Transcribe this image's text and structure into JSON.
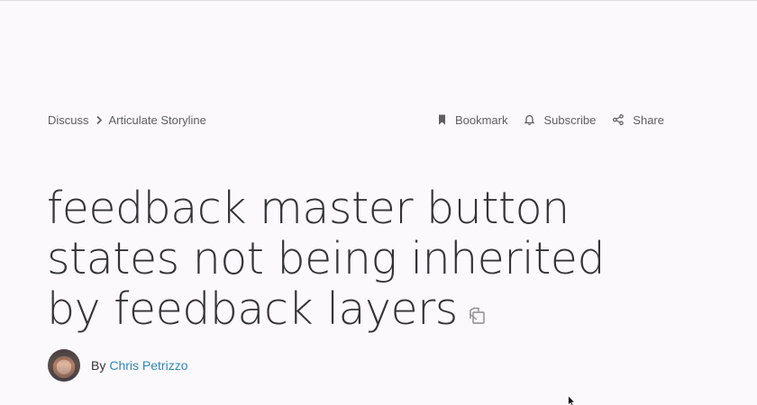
{
  "breadcrumb": {
    "items": [
      "Discuss",
      "Articulate Storyline"
    ]
  },
  "actions": {
    "bookmark": "Bookmark",
    "subscribe": "Subscribe",
    "share": "Share"
  },
  "post": {
    "title": "feedback master button states not being inherited by feedback layers",
    "by_label": "By",
    "author": "Chris Petrizzo"
  },
  "colors": {
    "background": "#fbf9fb",
    "text": "#333338",
    "muted": "#5d5d63",
    "link": "#2f86b8"
  },
  "icons": [
    "chevron-right-icon",
    "bookmark-icon",
    "bell-icon",
    "share-icon",
    "copy-link-icon",
    "mouse-cursor-icon"
  ]
}
